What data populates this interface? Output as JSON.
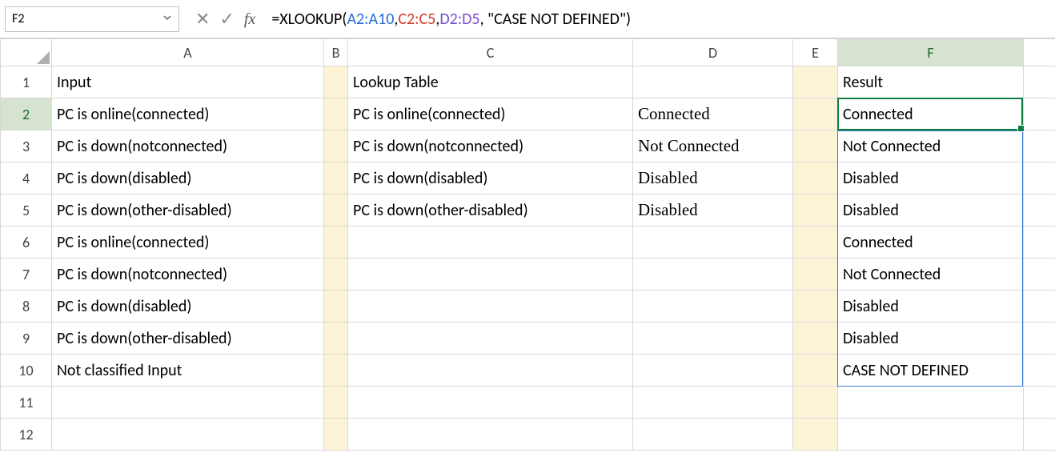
{
  "name_box": "F2",
  "formula": {
    "prefix": "=XLOOKUP(",
    "arg1": "A2:A10",
    "sep1": ",",
    "arg2": "C2:C5",
    "sep2": ",",
    "arg3": "D2:D5",
    "suffix": ", \"CASE NOT DEFINED\")"
  },
  "columns": [
    "A",
    "B",
    "C",
    "D",
    "E",
    "F"
  ],
  "row_numbers": [
    "1",
    "2",
    "3",
    "4",
    "5",
    "6",
    "7",
    "8",
    "9",
    "10",
    "11",
    "12"
  ],
  "cells": {
    "A1": "Input",
    "A2": "PC is online(connected)",
    "A3": "PC is down(notconnected)",
    "A4": "PC is down(disabled)",
    "A5": "PC is down(other-disabled)",
    "A6": "PC is online(connected)",
    "A7": "PC is down(notconnected)",
    "A8": "PC is down(disabled)",
    "A9": "PC is down(other-disabled)",
    "A10": "Not classified Input",
    "C1": "Lookup Table",
    "C2": "PC is online(connected)",
    "C3": "PC is down(notconnected)",
    "C4": "PC is down(disabled)",
    "C5": "PC is down(other-disabled)",
    "D2": "Connected",
    "D3": "Not Connected",
    "D4": "Disabled",
    "D5": "Disabled",
    "F1": "Result",
    "F2": "Connected",
    "F3": "Not Connected",
    "F4": "Disabled",
    "F5": "Disabled",
    "F6": "Connected",
    "F7": "Not Connected",
    "F8": "Disabled",
    "F9": "Disabled",
    "F10": "CASE NOT DEFINED"
  }
}
